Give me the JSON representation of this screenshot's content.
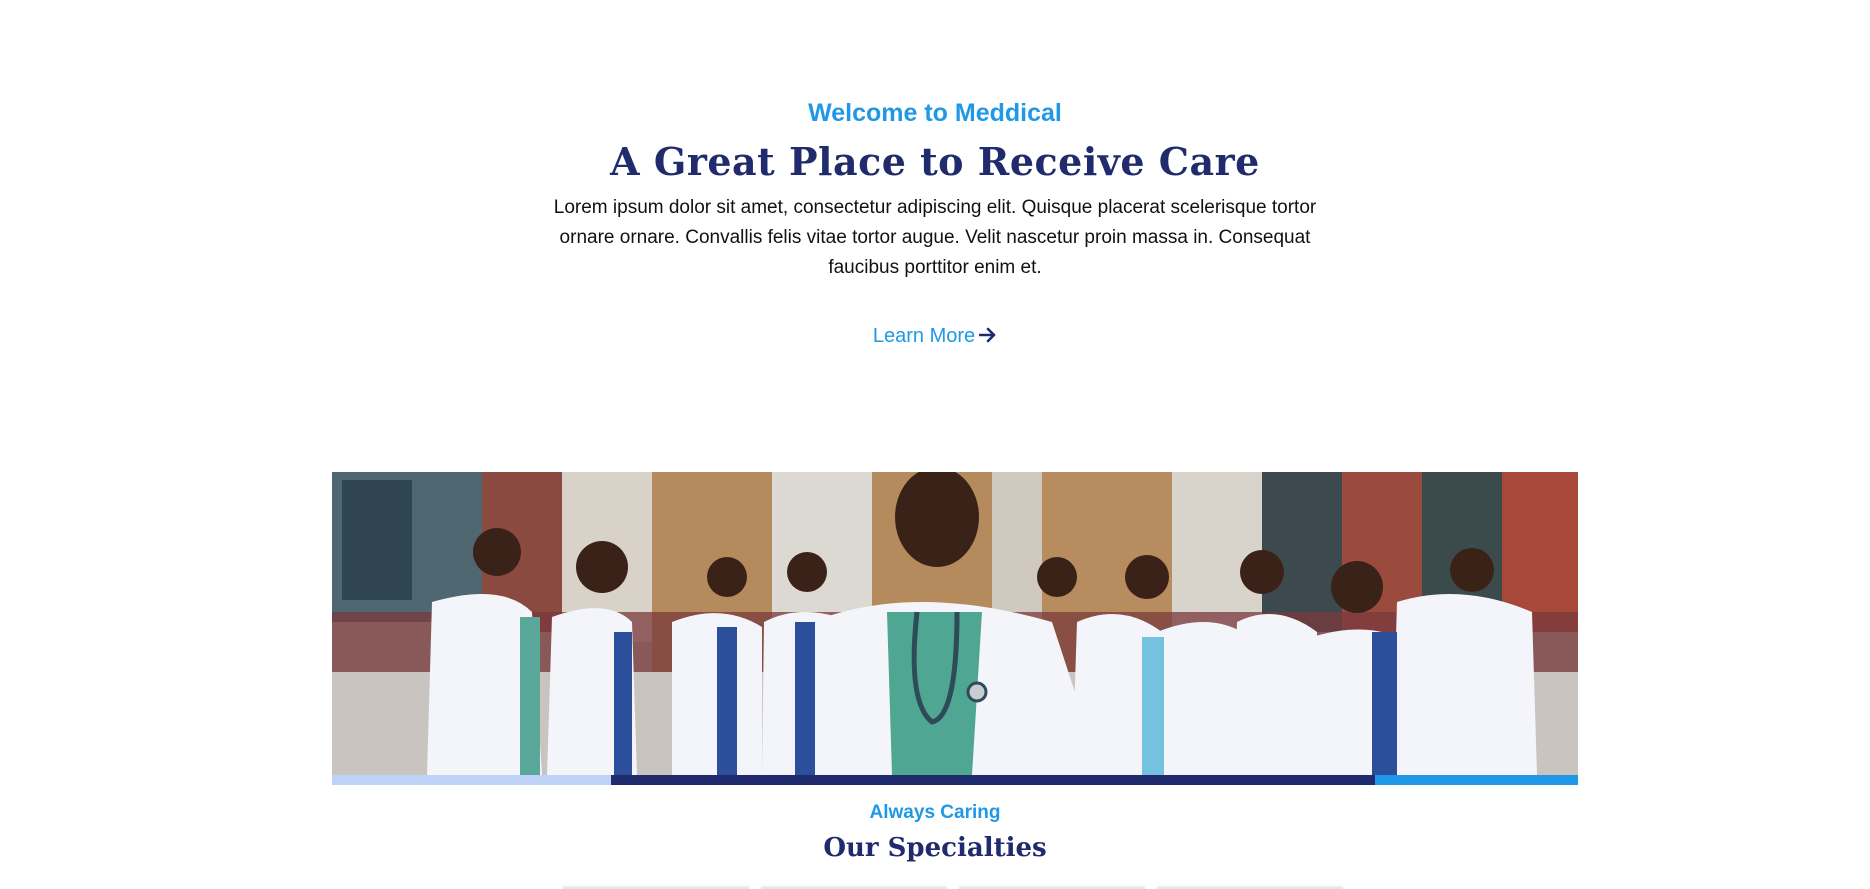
{
  "intro": {
    "eyebrow": "Welcome to Meddical",
    "headline": "A Great Place to Receive Care",
    "body": "Lorem ipsum dolor sit amet, consectetur adipiscing elit. Quisque placerat scelerisque tortor ornare ornare. Convallis felis vitae tortor augue. Velit nascetur proin massa in. Consequat faucibus porttitor enim et.",
    "cta_label": "Learn More",
    "cta_icon": "arrow-right-icon"
  },
  "hero": {
    "image": "group-of-doctors-photo"
  },
  "colors": {
    "accent": "#1f98e8",
    "brand_navy": "#1f2b6c",
    "light_blue": "#bfd2f8"
  },
  "specialties": {
    "eyebrow": "Always Caring",
    "title": "Our Specialties"
  }
}
